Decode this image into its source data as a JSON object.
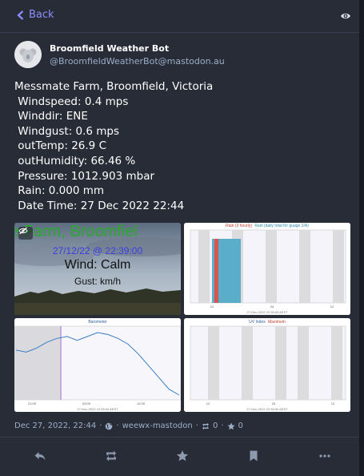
{
  "nav": {
    "back_label": "Back",
    "visibility_icon": "eye-icon"
  },
  "author": {
    "display_name": "Broomfield Weather Bot",
    "handle": "@BroomfieldWeatherBot@mastodon.au",
    "avatar_icon": "koala-avatar"
  },
  "post": {
    "lines": [
      "Messmate Farm, Broomfield, Victoria",
      " Windspeed: 0.4 mps",
      " Winddir: ENE",
      " Windgust: 0.6 mps",
      " outTemp: 26.9 C",
      " outHumidity: 66.46 %",
      " Pressure: 1012.903 mbar",
      " Rain: 0.000 mm",
      " Date Time: 27 Dec 2022 22:44"
    ]
  },
  "media": {
    "webcam": {
      "title": "e Farm, Broomfiel",
      "timestamp": "27/12/22 @ 22:39:00",
      "wind": "Wind: Calm",
      "gust": "Gust: km/h"
    },
    "rain_chart": {
      "title_a": "Rain (3 hourly)",
      "title_b": "Rain (daily total for guage 2/A)",
      "x_ticks": [
        "12",
        "24",
        "12"
      ],
      "footer": "27-Dec-2022 22:35:00 AEST",
      "series": [
        {
          "name": "Rain (3 hourly)",
          "color": "#d9534f"
        },
        {
          "name": "Rain (daily total for guage 2/A)",
          "color": "#5aaec9"
        }
      ]
    },
    "barometer_chart": {
      "title": "Barometer",
      "x_ticks": [
        "21:00",
        "03:00",
        "12:00"
      ],
      "footer": "27-Dec-2022 22:35:00 AEST",
      "line_color": "#3a7ec2",
      "values": [
        1015.2,
        1015.1,
        1015.3,
        1015.6,
        1015.8,
        1015.9,
        1015.7,
        1015.9,
        1016.1,
        1016.0,
        1015.8,
        1015.5,
        1015.0,
        1014.4,
        1013.8,
        1013.2,
        1012.9
      ]
    },
    "uv_chart": {
      "title_a": "UV Index",
      "title_b": "Maximum",
      "x_ticks": [
        "12",
        "24",
        "12"
      ],
      "footer": "27-Dec-2022 22:35:00 AEST"
    },
    "hide_icon": "eye-slash-icon"
  },
  "meta": {
    "timestamp": "Dec 27, 2022, 22:44",
    "separator": "·",
    "visibility_icon": "globe-icon",
    "app": "weewx-mastodon",
    "boosts": "0",
    "favourites": "0"
  },
  "actions": [
    "reply-icon",
    "boost-icon",
    "favourite-icon",
    "bookmark-icon",
    "more-icon"
  ],
  "colors": {
    "accent": "#8c8dff",
    "background": "#282c37",
    "muted": "#9baec8"
  }
}
